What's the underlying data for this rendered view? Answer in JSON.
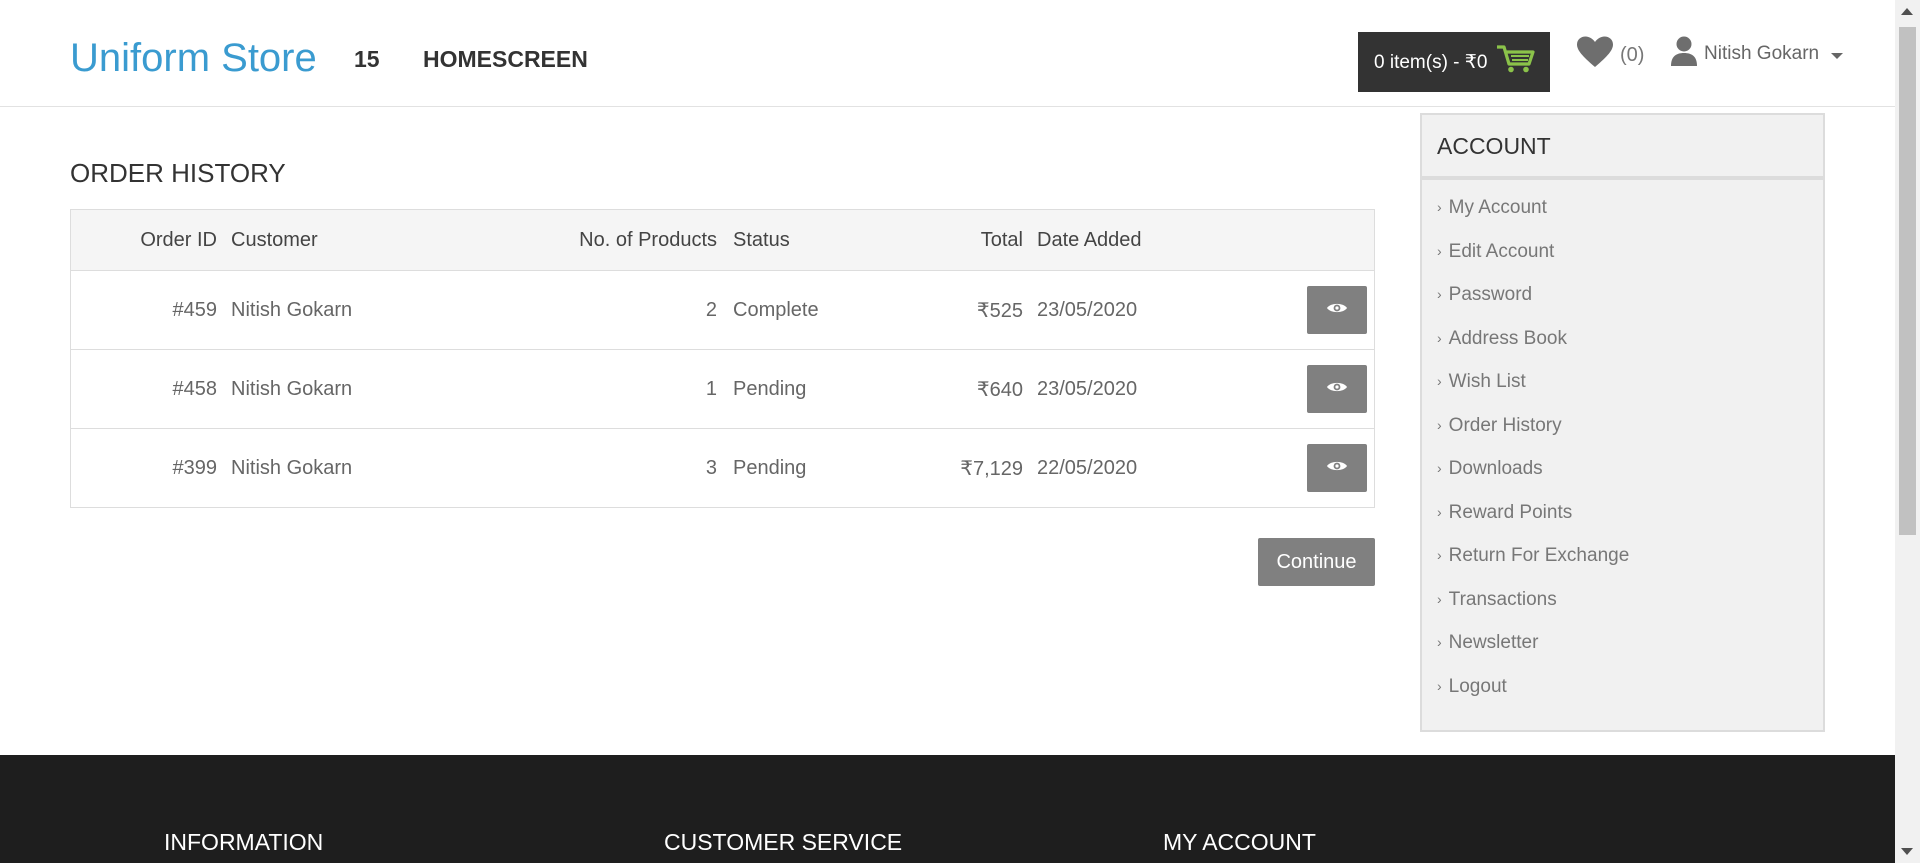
{
  "header": {
    "brand": "Uniform Store",
    "nav": [
      "15",
      "HOMESCREEN"
    ],
    "cart_label": "0 item(s) - ₹0",
    "wishlist_count": "(0)",
    "user_name": "Nitish Gokarn"
  },
  "page": {
    "title": "ORDER HISTORY",
    "columns": {
      "order_id": "Order ID",
      "customer": "Customer",
      "products": "No. of Products",
      "status": "Status",
      "total": "Total",
      "date": "Date Added"
    },
    "orders": [
      {
        "id": "#459",
        "customer": "Nitish Gokarn",
        "products": "2",
        "status": "Complete",
        "total": "₹525",
        "date": "23/05/2020"
      },
      {
        "id": "#458",
        "customer": "Nitish Gokarn",
        "products": "1",
        "status": "Pending",
        "total": "₹640",
        "date": "23/05/2020"
      },
      {
        "id": "#399",
        "customer": "Nitish Gokarn",
        "products": "3",
        "status": "Pending",
        "total": "₹7,129",
        "date": "22/05/2020"
      }
    ],
    "continue_label": "Continue"
  },
  "sidebar": {
    "title": "ACCOUNT",
    "items": [
      {
        "label": "My Account"
      },
      {
        "label": "Edit Account"
      },
      {
        "label": "Password"
      },
      {
        "label": "Address Book"
      },
      {
        "label": "Wish List"
      },
      {
        "label": "Order History"
      },
      {
        "label": "Downloads"
      },
      {
        "label": "Reward Points"
      },
      {
        "label": "Return For Exchange"
      },
      {
        "label": "Transactions"
      },
      {
        "label": "Newsletter"
      },
      {
        "label": "Logout"
      }
    ]
  },
  "footer": {
    "headings": [
      "INFORMATION",
      "CUSTOMER SERVICE",
      "MY ACCOUNT"
    ]
  },
  "colors": {
    "brand": "#3a9bd0",
    "cart_bg": "#333333",
    "cart_icon": "#8bc34a",
    "button_bg": "#808080",
    "footer_bg": "#1e1e1e"
  }
}
